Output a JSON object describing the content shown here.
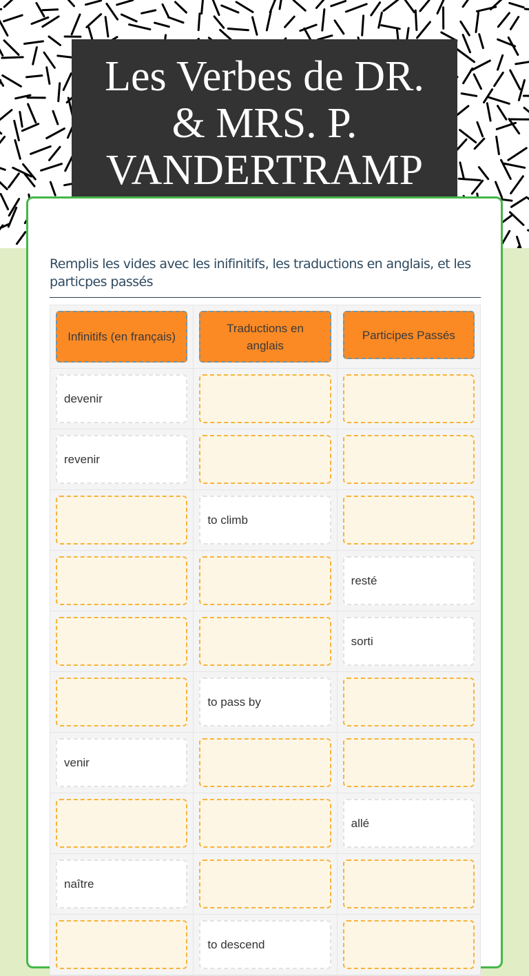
{
  "title": {
    "lines": [
      "Les Verbes de DR.",
      "& MRS. P.",
      "VANDERTRAMP"
    ]
  },
  "instructions": "Remplis les vides avec les inifinitifs, les traductions en anglais, et les particpes passés",
  "colors": {
    "header_fill": "#fb8a24",
    "blank_fill": "#fdf6e4",
    "blank_border": "#f7b33b",
    "card_border": "#45b649",
    "page_bg": "#e1edc4",
    "title_bg": "#333333"
  },
  "table": {
    "headers": [
      "Infinitifs (en français)",
      "Traductions en anglais",
      "Participes Passés"
    ],
    "rows": [
      [
        {
          "value": "devenir",
          "given": true
        },
        {
          "value": "",
          "given": false
        },
        {
          "value": "",
          "given": false
        }
      ],
      [
        {
          "value": "revenir",
          "given": true
        },
        {
          "value": "",
          "given": false
        },
        {
          "value": "",
          "given": false
        }
      ],
      [
        {
          "value": "",
          "given": false
        },
        {
          "value": "to climb",
          "given": true
        },
        {
          "value": "",
          "given": false
        }
      ],
      [
        {
          "value": "",
          "given": false
        },
        {
          "value": "",
          "given": false
        },
        {
          "value": "resté",
          "given": true
        }
      ],
      [
        {
          "value": "",
          "given": false
        },
        {
          "value": "",
          "given": false
        },
        {
          "value": "sorti",
          "given": true
        }
      ],
      [
        {
          "value": "",
          "given": false
        },
        {
          "value": "to pass by",
          "given": true
        },
        {
          "value": "",
          "given": false
        }
      ],
      [
        {
          "value": "venir",
          "given": true
        },
        {
          "value": "",
          "given": false
        },
        {
          "value": "",
          "given": false
        }
      ],
      [
        {
          "value": "",
          "given": false
        },
        {
          "value": "",
          "given": false
        },
        {
          "value": "allé",
          "given": true
        }
      ],
      [
        {
          "value": "naître",
          "given": true
        },
        {
          "value": "",
          "given": false
        },
        {
          "value": "",
          "given": false
        }
      ],
      [
        {
          "value": "",
          "given": false
        },
        {
          "value": "to descend",
          "given": true
        },
        {
          "value": "",
          "given": false
        }
      ]
    ]
  }
}
